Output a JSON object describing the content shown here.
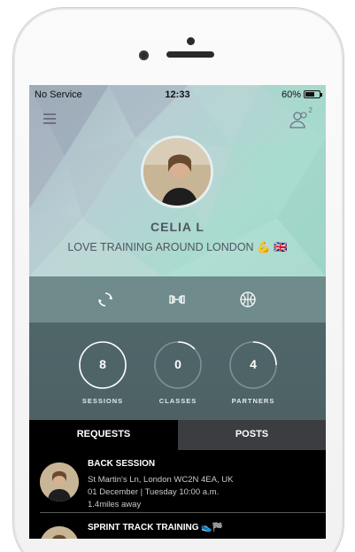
{
  "status_bar": {
    "carrier": "No Service",
    "time": "12:33",
    "battery": "60%"
  },
  "profile": {
    "name": "CELIA L",
    "tagline": "LOVE TRAINING AROUND LONDON 💪 🇬🇧",
    "partners_badge": "2"
  },
  "icons": [
    "sync-icon",
    "dumbbell-icon",
    "basketball-icon"
  ],
  "stats": [
    {
      "value": "8",
      "label": "SESSIONS",
      "progress": 1.0
    },
    {
      "value": "0",
      "label": "CLASSES",
      "progress": 0.0
    },
    {
      "value": "4",
      "label": "PARTNERS",
      "progress": 0.25
    }
  ],
  "tabs": {
    "requests": "REQUESTS",
    "posts": "POSTS"
  },
  "requests": [
    {
      "title": "BACK SESSION",
      "address": "St Martin's Ln, London WC2N 4EA, UK",
      "date": "01 December | Tuesday 10:00 a.m.",
      "distance": "1.4miles away"
    },
    {
      "title": "SPRINT TRACK TRAINING 👟🏁"
    }
  ],
  "colors": {
    "accent": "#a9dccf",
    "stats_bg": "#4f6669",
    "icons_bg": "#6f8b8c",
    "tab_inactive": "#3b3d41"
  }
}
